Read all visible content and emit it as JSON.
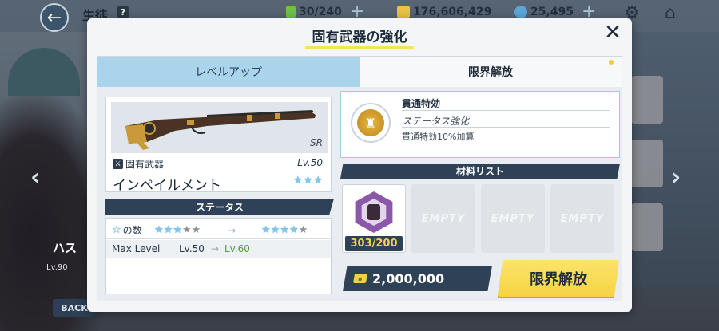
{
  "topbar": {
    "page_title": "生徒",
    "help": "?",
    "ap": "30/240",
    "credits": "176,606,429",
    "gems": "25,495"
  },
  "background": {
    "student_level_tag": "Lv.90",
    "student_name_fragment": "ハス",
    "back_label": "BACK"
  },
  "modal": {
    "title": "固有武器の強化",
    "tabs": [
      {
        "label": "レベルアップ"
      },
      {
        "label": "限界解放"
      }
    ]
  },
  "weapon": {
    "rarity": "SR",
    "type_label": "固有武器",
    "level": "Lv.50",
    "name": "インペイルメント",
    "stars": 3,
    "max_stars": 3
  },
  "status": {
    "header": "ステータス",
    "star_row_label": "の数",
    "star_from": 3,
    "star_to": 4,
    "star_total": 5,
    "arrow": "→",
    "max_level_label": "Max Level",
    "max_level_from": "Lv.50",
    "max_level_to": "Lv.60"
  },
  "effect": {
    "name": "貫通特効",
    "sub": "ステータス強化",
    "desc": "貫通特効10%加算"
  },
  "materials": {
    "header": "材料リスト",
    "items": [
      {
        "count": "303/200"
      }
    ],
    "empty_label": "EMPTY"
  },
  "cost": {
    "value": "2,000,000"
  },
  "action": {
    "limit_break_label": "限界解放"
  },
  "colors": {
    "accent_yellow": "#f5d442",
    "navy": "#2f4157",
    "tab_blue": "#a9d4ec",
    "level_up_green": "#4ba32e"
  }
}
